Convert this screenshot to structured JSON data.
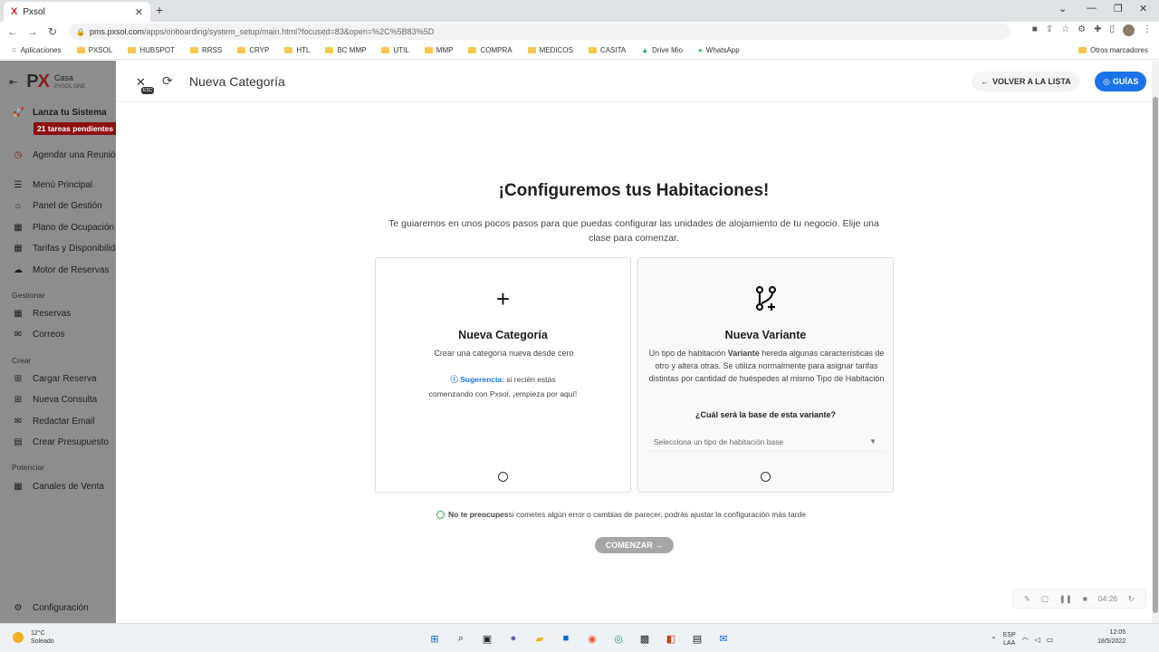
{
  "browser": {
    "tab_title": "Pxsol",
    "url_host": "pms.pxsol.com",
    "url_path": "/apps/onboarding/system_setup/main.html?focused=83&open=%2C%5B83%5D",
    "bookmarks": [
      "Aplicaciones",
      "PXSOL",
      "HUBSPOT",
      "RRSS",
      "CRYP",
      "HTL",
      "BC MMP",
      "UTIL",
      "MMP",
      "COMPRA",
      "MEDICOS",
      "CASITA",
      "Drive Mio",
      "WhatsApp"
    ],
    "other_bookmarks": "Otros marcadores"
  },
  "sidebar": {
    "property_name": "Casa",
    "property_sub": "PXSOL ONE",
    "launch_title": "Lanza tu Sistema",
    "pending_badge": "21 tareas pendientes",
    "schedule": "Agendar una Reunión",
    "items": [
      "Menú Principal",
      "Panel de Gestión",
      "Plano de Ocupación",
      "Tarifas y Disponibilidad",
      "Motor de Reservas"
    ],
    "section_manage": "Gestionar",
    "manage_items": [
      "Reservas",
      "Correos"
    ],
    "section_create": "Crear",
    "create_items": [
      "Cargar Reserva",
      "Nueva Consulta",
      "Redactar Email",
      "Crear Presupuesto"
    ],
    "section_boost": "Potenciar",
    "boost_items": [
      "Canales de Venta"
    ],
    "settings": "Configuración"
  },
  "header": {
    "esc": "ESC",
    "title": "Nueva Categoría",
    "back_button": "VOLVER A LA LISTA",
    "guides_button": "GUÍAS"
  },
  "content": {
    "heading": "¡Configuremos tus Habitaciones!",
    "intro": "Te guiaremos en unos pocos pasos para que puedas configurar las unidades de alojamiento de tu negocio. Elije una clase para comenzar.",
    "card_new": {
      "title": "Nueva Categoría",
      "description": "Crear una categoría nueva desde cero",
      "hint_label": "Sugerencia:",
      "hint_text_1": " si recién estás",
      "hint_text_2": "comenzando con Pxsol, ¡empieza por aquí!"
    },
    "card_variant": {
      "title": "Nueva Variante",
      "description_pre": "Un tipo de habitación ",
      "description_bold": "Variante",
      "description_post": " hereda algunas características de otro y altera otras. Se utiliza normalmente para asignar tarifas distintas por cantidad de huéspedes al mismo Tipo de Habitación",
      "question": "¿Cuál será la base de esta variante?",
      "select_placeholder": "Selecciona un tipo de habitación base"
    },
    "note_bold": "No te preocupes",
    "note_text": " si cometes algún error o cambias de parecer, podrás ajustar la configuración más tarde",
    "start_button": "COMENZAR →"
  },
  "recorder": {
    "time": "04:26"
  },
  "taskbar": {
    "temp": "12°C",
    "weather": "Soleado",
    "lang_1": "ESP",
    "lang_2": "LAA",
    "time": "12:05",
    "date": "18/5/2022"
  }
}
